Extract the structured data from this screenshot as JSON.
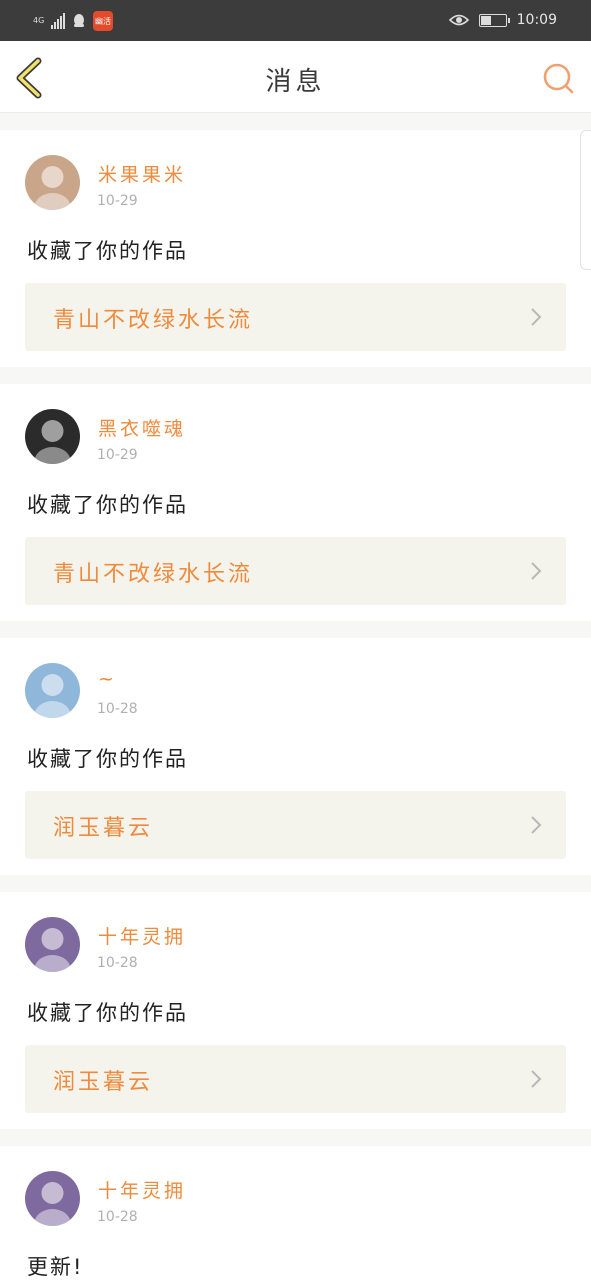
{
  "status_bar": {
    "network": "4G",
    "signal_sub": "4G",
    "app_badge": "幽活",
    "time": "10:09",
    "battery_level": 0.4
  },
  "nav": {
    "title": "消息"
  },
  "messages": [
    {
      "user": "米果果米",
      "date": "10-29",
      "action": "收藏了你的作品",
      "work": "青山不改绿水长流",
      "avatar_color": "#c9a58a"
    },
    {
      "user": "黑衣噬魂",
      "date": "10-29",
      "action": "收藏了你的作品",
      "work": "青山不改绿水长流",
      "avatar_color": "#2b2b2b"
    },
    {
      "user": "~",
      "date": "10-28",
      "action": "收藏了你的作品",
      "work": "润玉暮云",
      "avatar_color": "#8fb7d9"
    },
    {
      "user": "十年灵拥",
      "date": "10-28",
      "action": "收藏了你的作品",
      "work": "润玉暮云",
      "avatar_color": "#7e6a9e"
    },
    {
      "user": "十年灵拥",
      "date": "10-28",
      "action": "更新!",
      "work": "",
      "avatar_color": "#7e6a9e"
    }
  ]
}
